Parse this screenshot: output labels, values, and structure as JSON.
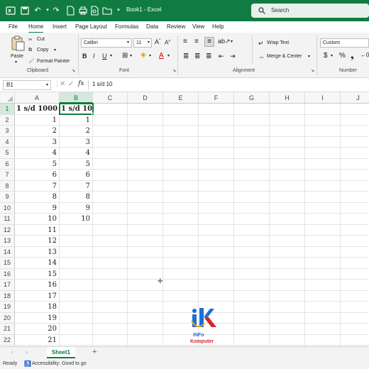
{
  "title_bar": {
    "title": "Book1 - Excel",
    "search_placeholder": "Search"
  },
  "menu_tabs": [
    "File",
    "Home",
    "Insert",
    "Page Layout",
    "Formulas",
    "Data",
    "Review",
    "View",
    "Help"
  ],
  "ribbon": {
    "clipboard": {
      "paste": "Paste",
      "cut": "Cut",
      "copy": "Copy",
      "format_painter": "Format Painter",
      "group": "Clipboard"
    },
    "font": {
      "name": "Calibri",
      "size": "11",
      "group": "Font"
    },
    "alignment": {
      "wrap_text": "Wrap Text",
      "merge_center": "Merge & Center",
      "group": "Alignment"
    },
    "number": {
      "format": "Custom",
      "group": "Number"
    }
  },
  "formula_bar": {
    "name_box": "B1",
    "fx": "fx",
    "value": "1 s/d 10"
  },
  "columns": [
    "A",
    "B",
    "C",
    "D",
    "E",
    "F",
    "G",
    "H",
    "I",
    "J"
  ],
  "rows": [
    "1",
    "2",
    "3",
    "4",
    "5",
    "6",
    "7",
    "8",
    "9",
    "10",
    "11",
    "12",
    "13",
    "14",
    "15",
    "16",
    "17",
    "18",
    "19",
    "20",
    "21",
    "22"
  ],
  "col_a": [
    "1 s/d 1000",
    "1",
    "2",
    "3",
    "4",
    "5",
    "6",
    "7",
    "8",
    "9",
    "10",
    "11",
    "12",
    "13",
    "14",
    "15",
    "16",
    "17",
    "18",
    "19",
    "20",
    "21"
  ],
  "col_b": [
    "1 s/d 10",
    "1",
    "2",
    "3",
    "4",
    "5",
    "6",
    "7",
    "8",
    "9",
    "10"
  ],
  "sheet": {
    "name": "Sheet1",
    "add": "+"
  },
  "status": {
    "ready": "Ready",
    "accessibility": "Accessibility: Good to go"
  },
  "logo": {
    "line1": "iNFo",
    "line2": "Komputer"
  },
  "colors": {
    "brand": "#107c41",
    "logo_blue": "#1d6fd6",
    "logo_red": "#d6262a"
  }
}
